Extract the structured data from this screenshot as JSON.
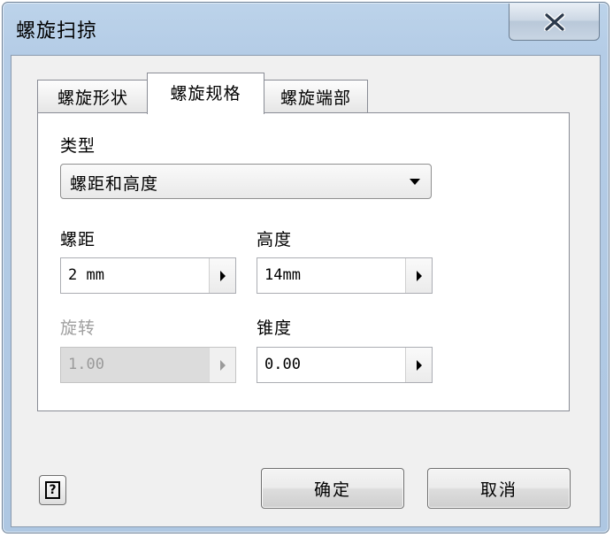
{
  "dialog": {
    "title": "螺旋扫掠"
  },
  "tabs": [
    {
      "label": "螺旋形状",
      "active": false
    },
    {
      "label": "螺旋规格",
      "active": true
    },
    {
      "label": "螺旋端部",
      "active": false
    }
  ],
  "type_section": {
    "label": "类型",
    "selected": "螺距和高度"
  },
  "pitch": {
    "label": "螺距",
    "value": "2 mm"
  },
  "height": {
    "label": "高度",
    "value": "14mm"
  },
  "revolution": {
    "label": "旋转",
    "value": "1.00",
    "enabled": false
  },
  "taper": {
    "label": "锥度",
    "value": "0.00"
  },
  "buttons": {
    "help_glyph": "?",
    "ok": "确定",
    "cancel": "取消"
  },
  "colors": {
    "frame": "#b4cce6",
    "client": "#f0f0f0",
    "disabled_text": "#a0a0a0"
  }
}
